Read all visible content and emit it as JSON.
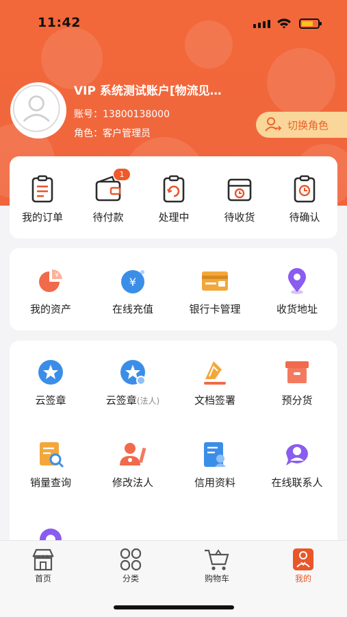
{
  "status": {
    "time": "11:42"
  },
  "profile": {
    "name": "VIP 系统测试账户[物流见…",
    "account_line": "账号：13800138000",
    "role_line": "角色：客户管理员",
    "switch_role_label": "切换角色"
  },
  "orders": [
    {
      "label": "我的订单",
      "icon": "order-list-icon"
    },
    {
      "label": "待付款",
      "icon": "wallet-icon",
      "badge": "1"
    },
    {
      "label": "处理中",
      "icon": "processing-clipboard-icon"
    },
    {
      "label": "待收货",
      "icon": "receive-box-icon"
    },
    {
      "label": "待确认",
      "icon": "confirm-clock-icon"
    }
  ],
  "finance": [
    {
      "label": "我的资产",
      "icon": "assets-pie-icon"
    },
    {
      "label": "在线充值",
      "icon": "recharge-yen-icon"
    },
    {
      "label": "银行卡管理",
      "icon": "bank-card-icon"
    },
    {
      "label": "收货地址",
      "icon": "location-pin-icon"
    }
  ],
  "tools": [
    {
      "label": "云签章",
      "icon": "cloud-seal-icon"
    },
    {
      "label": "云签章",
      "sub": "(法人)",
      "icon": "cloud-seal-legal-icon"
    },
    {
      "label": "文档签署",
      "icon": "document-sign-icon"
    },
    {
      "label": "预分货",
      "icon": "pre-allocate-box-icon"
    },
    {
      "label": "销量查询",
      "icon": "sales-query-icon"
    },
    {
      "label": "修改法人",
      "icon": "edit-legal-person-icon"
    },
    {
      "label": "信用资料",
      "icon": "credit-profile-icon"
    },
    {
      "label": "在线联系人",
      "icon": "online-contact-icon"
    },
    {
      "label": "",
      "icon": "settings-gear-icon"
    }
  ],
  "tabs": [
    {
      "label": "首页",
      "icon": "home-store-icon"
    },
    {
      "label": "分类",
      "icon": "category-grid-icon"
    },
    {
      "label": "购物车",
      "icon": "cart-icon"
    },
    {
      "label": "我的",
      "icon": "profile-person-icon"
    }
  ],
  "colors": {
    "brand": "#f2683a",
    "accent": "#e8562a",
    "switch_bg": "#fbd69a"
  }
}
